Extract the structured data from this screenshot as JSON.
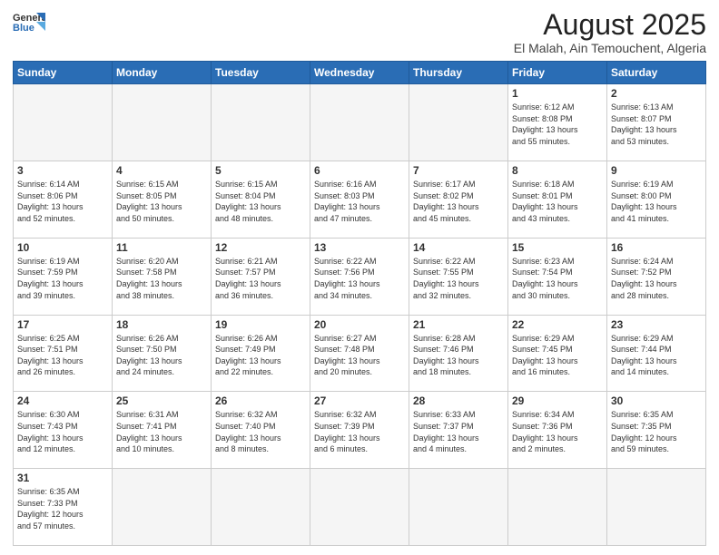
{
  "header": {
    "logo_general": "General",
    "logo_blue": "Blue",
    "title": "August 2025",
    "subtitle": "El Malah, Ain Temouchent, Algeria"
  },
  "weekdays": [
    "Sunday",
    "Monday",
    "Tuesday",
    "Wednesday",
    "Thursday",
    "Friday",
    "Saturday"
  ],
  "weeks": [
    [
      {
        "day": "",
        "info": ""
      },
      {
        "day": "",
        "info": ""
      },
      {
        "day": "",
        "info": ""
      },
      {
        "day": "",
        "info": ""
      },
      {
        "day": "",
        "info": ""
      },
      {
        "day": "1",
        "info": "Sunrise: 6:12 AM\nSunset: 8:08 PM\nDaylight: 13 hours\nand 55 minutes."
      },
      {
        "day": "2",
        "info": "Sunrise: 6:13 AM\nSunset: 8:07 PM\nDaylight: 13 hours\nand 53 minutes."
      }
    ],
    [
      {
        "day": "3",
        "info": "Sunrise: 6:14 AM\nSunset: 8:06 PM\nDaylight: 13 hours\nand 52 minutes."
      },
      {
        "day": "4",
        "info": "Sunrise: 6:15 AM\nSunset: 8:05 PM\nDaylight: 13 hours\nand 50 minutes."
      },
      {
        "day": "5",
        "info": "Sunrise: 6:15 AM\nSunset: 8:04 PM\nDaylight: 13 hours\nand 48 minutes."
      },
      {
        "day": "6",
        "info": "Sunrise: 6:16 AM\nSunset: 8:03 PM\nDaylight: 13 hours\nand 47 minutes."
      },
      {
        "day": "7",
        "info": "Sunrise: 6:17 AM\nSunset: 8:02 PM\nDaylight: 13 hours\nand 45 minutes."
      },
      {
        "day": "8",
        "info": "Sunrise: 6:18 AM\nSunset: 8:01 PM\nDaylight: 13 hours\nand 43 minutes."
      },
      {
        "day": "9",
        "info": "Sunrise: 6:19 AM\nSunset: 8:00 PM\nDaylight: 13 hours\nand 41 minutes."
      }
    ],
    [
      {
        "day": "10",
        "info": "Sunrise: 6:19 AM\nSunset: 7:59 PM\nDaylight: 13 hours\nand 39 minutes."
      },
      {
        "day": "11",
        "info": "Sunrise: 6:20 AM\nSunset: 7:58 PM\nDaylight: 13 hours\nand 38 minutes."
      },
      {
        "day": "12",
        "info": "Sunrise: 6:21 AM\nSunset: 7:57 PM\nDaylight: 13 hours\nand 36 minutes."
      },
      {
        "day": "13",
        "info": "Sunrise: 6:22 AM\nSunset: 7:56 PM\nDaylight: 13 hours\nand 34 minutes."
      },
      {
        "day": "14",
        "info": "Sunrise: 6:22 AM\nSunset: 7:55 PM\nDaylight: 13 hours\nand 32 minutes."
      },
      {
        "day": "15",
        "info": "Sunrise: 6:23 AM\nSunset: 7:54 PM\nDaylight: 13 hours\nand 30 minutes."
      },
      {
        "day": "16",
        "info": "Sunrise: 6:24 AM\nSunset: 7:52 PM\nDaylight: 13 hours\nand 28 minutes."
      }
    ],
    [
      {
        "day": "17",
        "info": "Sunrise: 6:25 AM\nSunset: 7:51 PM\nDaylight: 13 hours\nand 26 minutes."
      },
      {
        "day": "18",
        "info": "Sunrise: 6:26 AM\nSunset: 7:50 PM\nDaylight: 13 hours\nand 24 minutes."
      },
      {
        "day": "19",
        "info": "Sunrise: 6:26 AM\nSunset: 7:49 PM\nDaylight: 13 hours\nand 22 minutes."
      },
      {
        "day": "20",
        "info": "Sunrise: 6:27 AM\nSunset: 7:48 PM\nDaylight: 13 hours\nand 20 minutes."
      },
      {
        "day": "21",
        "info": "Sunrise: 6:28 AM\nSunset: 7:46 PM\nDaylight: 13 hours\nand 18 minutes."
      },
      {
        "day": "22",
        "info": "Sunrise: 6:29 AM\nSunset: 7:45 PM\nDaylight: 13 hours\nand 16 minutes."
      },
      {
        "day": "23",
        "info": "Sunrise: 6:29 AM\nSunset: 7:44 PM\nDaylight: 13 hours\nand 14 minutes."
      }
    ],
    [
      {
        "day": "24",
        "info": "Sunrise: 6:30 AM\nSunset: 7:43 PM\nDaylight: 13 hours\nand 12 minutes."
      },
      {
        "day": "25",
        "info": "Sunrise: 6:31 AM\nSunset: 7:41 PM\nDaylight: 13 hours\nand 10 minutes."
      },
      {
        "day": "26",
        "info": "Sunrise: 6:32 AM\nSunset: 7:40 PM\nDaylight: 13 hours\nand 8 minutes."
      },
      {
        "day": "27",
        "info": "Sunrise: 6:32 AM\nSunset: 7:39 PM\nDaylight: 13 hours\nand 6 minutes."
      },
      {
        "day": "28",
        "info": "Sunrise: 6:33 AM\nSunset: 7:37 PM\nDaylight: 13 hours\nand 4 minutes."
      },
      {
        "day": "29",
        "info": "Sunrise: 6:34 AM\nSunset: 7:36 PM\nDaylight: 13 hours\nand 2 minutes."
      },
      {
        "day": "30",
        "info": "Sunrise: 6:35 AM\nSunset: 7:35 PM\nDaylight: 12 hours\nand 59 minutes."
      }
    ],
    [
      {
        "day": "31",
        "info": "Sunrise: 6:35 AM\nSunset: 7:33 PM\nDaylight: 12 hours\nand 57 minutes."
      },
      {
        "day": "",
        "info": ""
      },
      {
        "day": "",
        "info": ""
      },
      {
        "day": "",
        "info": ""
      },
      {
        "day": "",
        "info": ""
      },
      {
        "day": "",
        "info": ""
      },
      {
        "day": "",
        "info": ""
      }
    ]
  ]
}
